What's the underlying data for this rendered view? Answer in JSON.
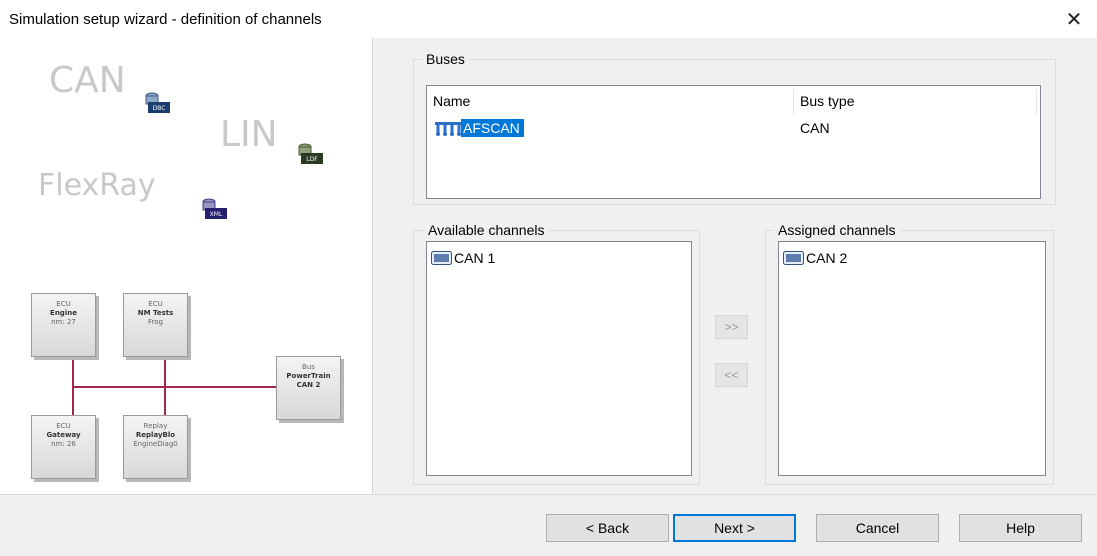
{
  "window": {
    "title": "Simulation setup wizard - definition of channels"
  },
  "illustration": {
    "bus_words": [
      "CAN",
      "LIN",
      "FlexRay"
    ],
    "db_icons": [
      "DBC",
      "LDF",
      "XML"
    ],
    "ecus": [
      {
        "type": "ECU",
        "name": "Engine",
        "detail": "nm: 27"
      },
      {
        "type": "ECU",
        "name": "NM Tests",
        "detail": "Frog"
      },
      {
        "type": "Bus",
        "name": "PowerTrain",
        "detail": "CAN 2"
      },
      {
        "type": "ECU",
        "name": "Gateway",
        "detail": "nm: 26"
      },
      {
        "type": "Replay",
        "name": "ReplayBlo",
        "detail": "EngineDiag0"
      }
    ],
    "wire_color": "#a0284a"
  },
  "buses": {
    "legend": "Buses",
    "columns": [
      "Name",
      "Bus type"
    ],
    "rows": [
      {
        "name": "AFSCAN",
        "type": "CAN",
        "icon": "bus-network-icon"
      }
    ],
    "selection_color": "#0078d7"
  },
  "available": {
    "legend": "Available channels",
    "items": [
      {
        "label": "CAN 1",
        "icon": "channel-icon"
      }
    ]
  },
  "assigned": {
    "legend": "Assigned channels",
    "items": [
      {
        "label": "CAN 2",
        "icon": "channel-icon"
      }
    ]
  },
  "move_buttons": {
    "assign": ">>",
    "unassign": "<<"
  },
  "footer": {
    "back": "< Back",
    "next": "Next >",
    "cancel": "Cancel",
    "help": "Help"
  }
}
